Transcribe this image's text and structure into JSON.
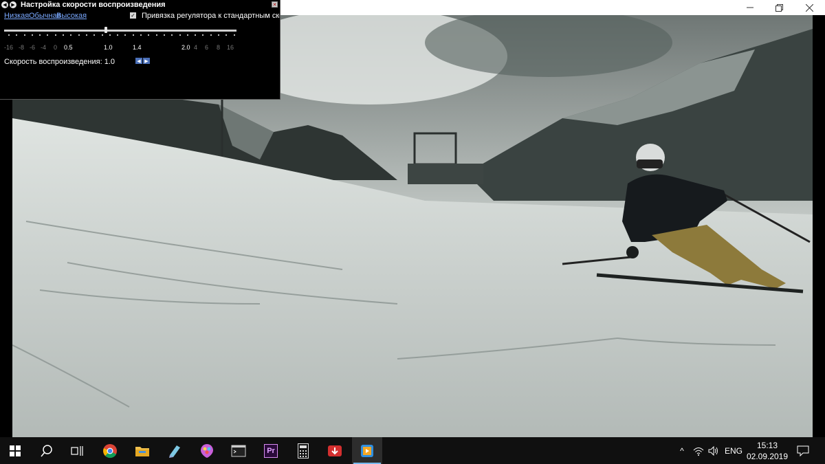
{
  "dialog": {
    "title": "Настройка скорости воспроизведения",
    "presets": [
      "Низкая",
      "Обычная",
      "Высокая"
    ],
    "checkbox_checked": true,
    "checkbox_label": "Привязка регулятора к стандартным скорос",
    "slider_ticks": [
      "-16",
      "-8",
      "-6",
      "-4",
      "0",
      "0.5",
      "1.0",
      "1.4",
      "2.0",
      "4",
      "6",
      "8",
      "16"
    ],
    "speed_label": "Скорость воспроизведения: 1.0",
    "speed_value": 1.0
  },
  "taskbar": {
    "apps": [
      "windows-start-icon",
      "search-icon",
      "task-view-icon",
      "chrome-icon",
      "file-explorer-icon",
      "notepad-icon",
      "paint-icon",
      "terminal-icon",
      "premiere-pro-icon",
      "calculator-icon",
      "download-manager-icon",
      "media-player-icon"
    ],
    "premiere_label": "Pr",
    "tray": {
      "chevron": "^",
      "language": "ENG",
      "time": "15:13",
      "date": "02.09.2019"
    }
  }
}
